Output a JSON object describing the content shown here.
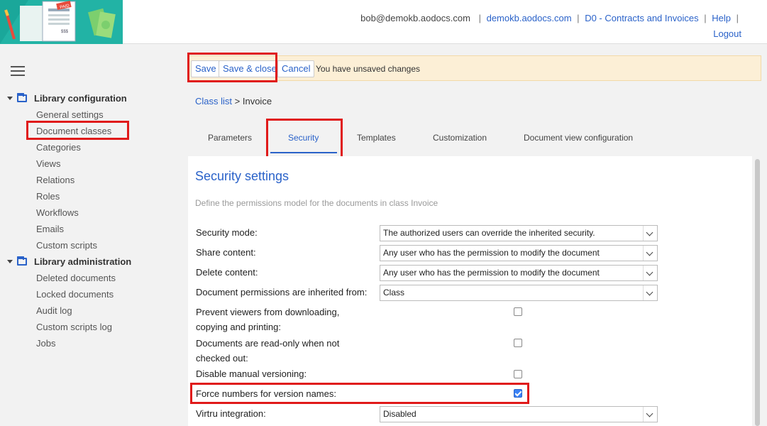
{
  "header": {
    "user_email": "bob@demokb.aodocs.com",
    "domain_link": "demokb.aodocs.com",
    "library_link": "D0 - Contracts and Invoices",
    "help_link": "Help",
    "logout_link": "Logout",
    "separator": "|",
    "logo_badge": "PAID",
    "logo_amount": "$$$"
  },
  "sidebar": {
    "groups": [
      {
        "title": "Library configuration",
        "items": [
          "General settings",
          "Document classes",
          "Categories",
          "Views",
          "Relations",
          "Roles",
          "Workflows",
          "Emails",
          "Custom scripts"
        ]
      },
      {
        "title": "Library administration",
        "items": [
          "Deleted documents",
          "Locked documents",
          "Audit log",
          "Custom scripts log",
          "Jobs"
        ]
      }
    ]
  },
  "toolbar": {
    "save_label": "Save",
    "save_close_label": "Save & close",
    "cancel_label": "Cancel",
    "message": "You have unsaved changes"
  },
  "breadcrumb": {
    "link": "Class list",
    "separator": ">",
    "current": "Invoice"
  },
  "tabs": [
    "Parameters",
    "Security",
    "Templates",
    "Customization",
    "Document view configuration"
  ],
  "active_tab": "Security",
  "security": {
    "title": "Security settings",
    "description": "Define the permissions model for the documents in class Invoice",
    "fields": [
      {
        "label": "Security mode:",
        "type": "select",
        "value": "The authorized users can override the inherited security."
      },
      {
        "label": "Share content:",
        "type": "select",
        "value": "Any user who has the permission to modify the document"
      },
      {
        "label": "Delete content:",
        "type": "select",
        "value": "Any user who has the permission to modify the document"
      },
      {
        "label": "Document permissions are inherited from:",
        "type": "select",
        "value": "Class"
      },
      {
        "label": "Prevent viewers from downloading, copying and printing:",
        "type": "checkbox",
        "checked": false
      },
      {
        "label": "Documents are read-only when not checked out:",
        "type": "checkbox",
        "checked": false
      },
      {
        "label": "Disable manual versioning:",
        "type": "checkbox",
        "checked": false
      },
      {
        "label": "Force numbers for version names:",
        "type": "checkbox",
        "checked": true
      },
      {
        "label": "Virtru integration:",
        "type": "select",
        "value": "Disabled"
      }
    ]
  },
  "colors": {
    "accent": "#2a62c9",
    "highlight_box": "#e01a1a",
    "toolbar_bg": "#fcefd6",
    "logo_bg": "#1aa79a"
  }
}
